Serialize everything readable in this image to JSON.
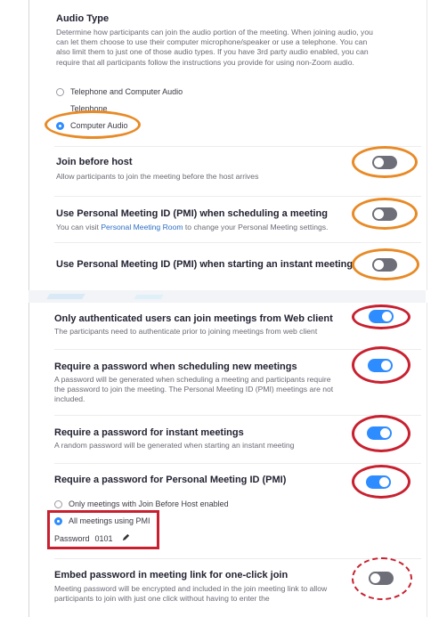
{
  "audio_type": {
    "title": "Audio Type",
    "description": "Determine how participants can join the audio portion of the meeting. When joining audio, you can let them choose to use their computer microphone/speaker or use a telephone. You can also limit them to just one of those audio types. If you have 3rd party audio enabled, you can require that all participants follow the instructions you provide for using non-Zoom audio.",
    "options": [
      "Telephone and Computer Audio",
      "Telephone",
      "Computer Audio"
    ],
    "selected": "Computer Audio"
  },
  "settings": {
    "join_before_host": {
      "title": "Join before host",
      "description": "Allow participants to join the meeting before the host arrives",
      "enabled": false
    },
    "pmi_scheduling": {
      "title": "Use Personal Meeting ID (PMI) when scheduling a meeting",
      "description_prefix": "You can visit",
      "link_text": "Personal Meeting Room",
      "description_suffix": "to change your Personal Meeting settings.",
      "enabled": false
    },
    "pmi_instant": {
      "title": "Use Personal Meeting ID (PMI) when starting an instant meeting",
      "enabled": false
    },
    "authenticated_web": {
      "title": "Only authenticated users can join meetings from Web client",
      "description": "The participants need to authenticate prior to joining meetings from web client",
      "enabled": true
    },
    "password_scheduling": {
      "title": "Require a password when scheduling new meetings",
      "description": "A password will be generated when scheduling a meeting and participants require the password to join the meeting. The Personal Meeting ID (PMI) meetings are not included.",
      "enabled": true
    },
    "password_instant": {
      "title": "Require a password for instant meetings",
      "description": "A random password will be generated when starting an instant meeting",
      "enabled": true
    },
    "password_pmi": {
      "title": "Require a password for Personal Meeting ID (PMI)",
      "options": [
        "Only meetings with Join Before Host enabled",
        "All meetings using PMI"
      ],
      "selected": "All meetings using PMI",
      "password_label": "Password",
      "password_value": "0101",
      "enabled": true
    },
    "embed_password": {
      "title": "Embed password in meeting link for one-click join",
      "description": "Meeting password will be encrypted and included in the join meeting link to allow participants to join with just one click without having to enter the",
      "enabled": false
    }
  },
  "colors": {
    "accent": "#2d8cff",
    "toggle_off": "#6e6e78",
    "highlight_orange": "#e88a26",
    "highlight_red": "#c8202f"
  }
}
